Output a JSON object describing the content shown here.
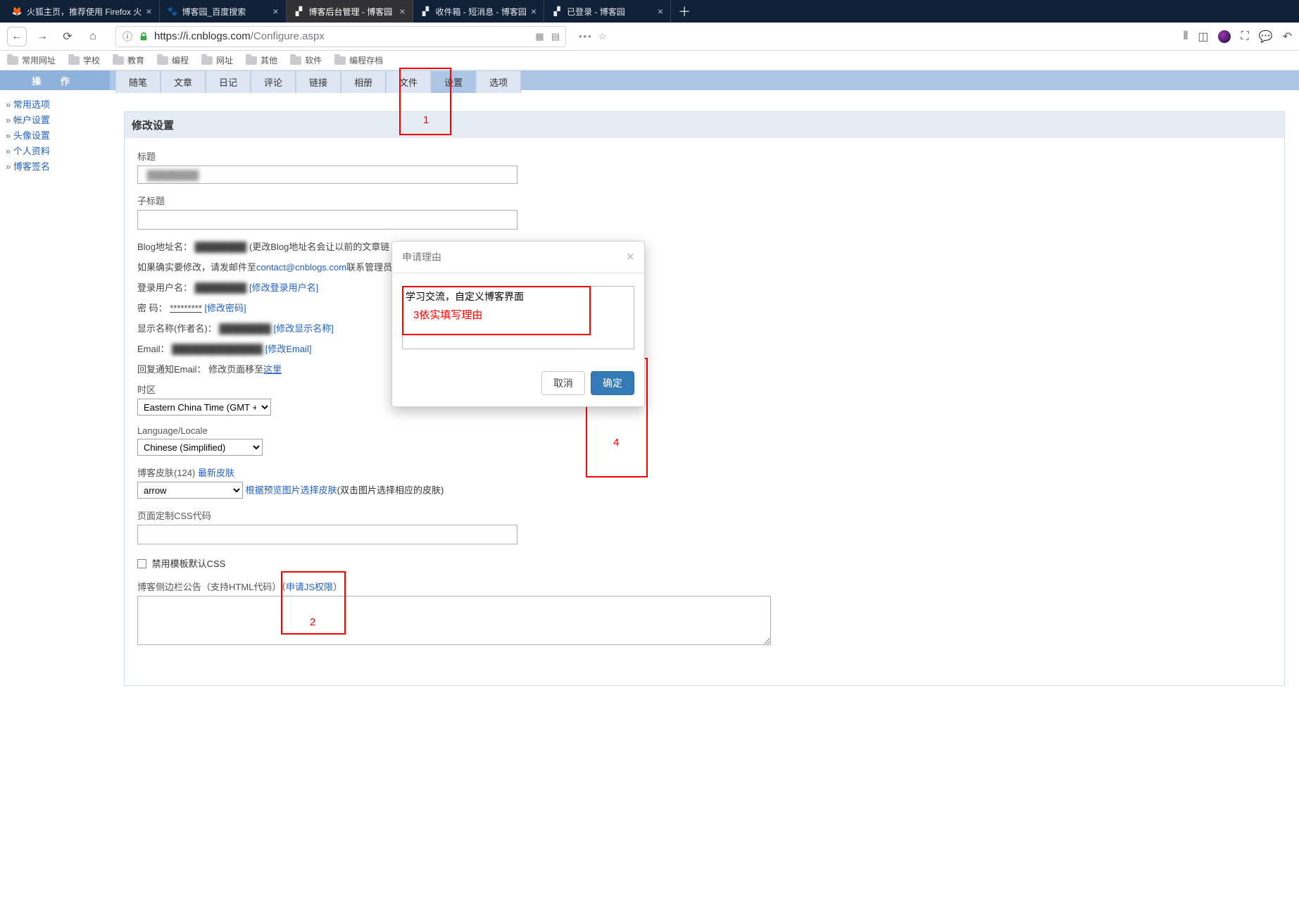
{
  "browser": {
    "tabs": [
      {
        "title": "火狐主页，推荐使用 Firefox 火",
        "active": false
      },
      {
        "title": "博客园_百度搜索",
        "active": false
      },
      {
        "title": "博客后台管理 - 博客园",
        "active": true
      },
      {
        "title": "收件箱 - 短消息 - 博客园",
        "active": false
      },
      {
        "title": "已登录 - 博客园",
        "active": false
      }
    ],
    "url_host": "https://i.cnblogs.com",
    "url_path": "/Configure.aspx"
  },
  "bookmarks": [
    "常用网址",
    "学校",
    "教育",
    "编程",
    "网址",
    "其他",
    "软件",
    "编程存档"
  ],
  "sidebar": {
    "header": "操 作",
    "links": [
      "常用选项",
      "帐户设置",
      "头像设置",
      "个人资料",
      "博客签名"
    ]
  },
  "top_tabs": [
    "随笔",
    "文章",
    "日记",
    "评论",
    "链接",
    "相册",
    "文件",
    "设置",
    "选项"
  ],
  "top_tabs_active": 7,
  "card": {
    "title": "修改设置",
    "labels": {
      "title": "标题",
      "subtitle": "子标题",
      "blog_addr_name": "Blog地址名：",
      "blog_addr_hint": "(更改Blog地址名会让以前的文章链",
      "blog_addr_hint2": "如果确实要修改，请发邮件至",
      "contact_email": "contact@cnblogs.com",
      "contact_tail": "联系管理员修",
      "login_user": "登录用户名：",
      "login_user_link": "[修改登录用户名]",
      "password": "密      码：",
      "password_mask": "*********",
      "password_link": "[修改密码]",
      "display_name": "显示名称(作者名)：",
      "display_name_link": "[修改显示名称]",
      "email": "Email：",
      "email_link": "[修改Email]",
      "reply_notify": "回复通知Email：   修改页面移至",
      "reply_here": "这里",
      "timezone": "时区",
      "locale": "Language/Locale",
      "skin_label_a": "博客皮肤(124) ",
      "skin_latest": "最新皮肤",
      "skin_preview": "根据预览图片选择皮肤",
      "skin_tail": "(双击图片选择相应的皮肤)",
      "css_label": "页面定制CSS代码",
      "disable_css": "禁用模板默认CSS",
      "sidebar_ann": "博客侧边栏公告（支持HTML代码）（",
      "apply_js": "申请JS权限",
      "close_paren": "）"
    },
    "values": {
      "title_value": "",
      "subtitle_value": "",
      "timezone_sel": "Eastern China Time (GMT +8)",
      "locale_sel": "Chinese (Simplified)",
      "skin_sel": "arrow"
    }
  },
  "modal": {
    "title": "申请理由",
    "textarea_value": "学习交流，自定义博客界面",
    "cancel": "取消",
    "ok": "确定"
  },
  "annotations": {
    "n1": "1",
    "n2": "2",
    "n3": "3依实填写理由",
    "n4": "4"
  }
}
